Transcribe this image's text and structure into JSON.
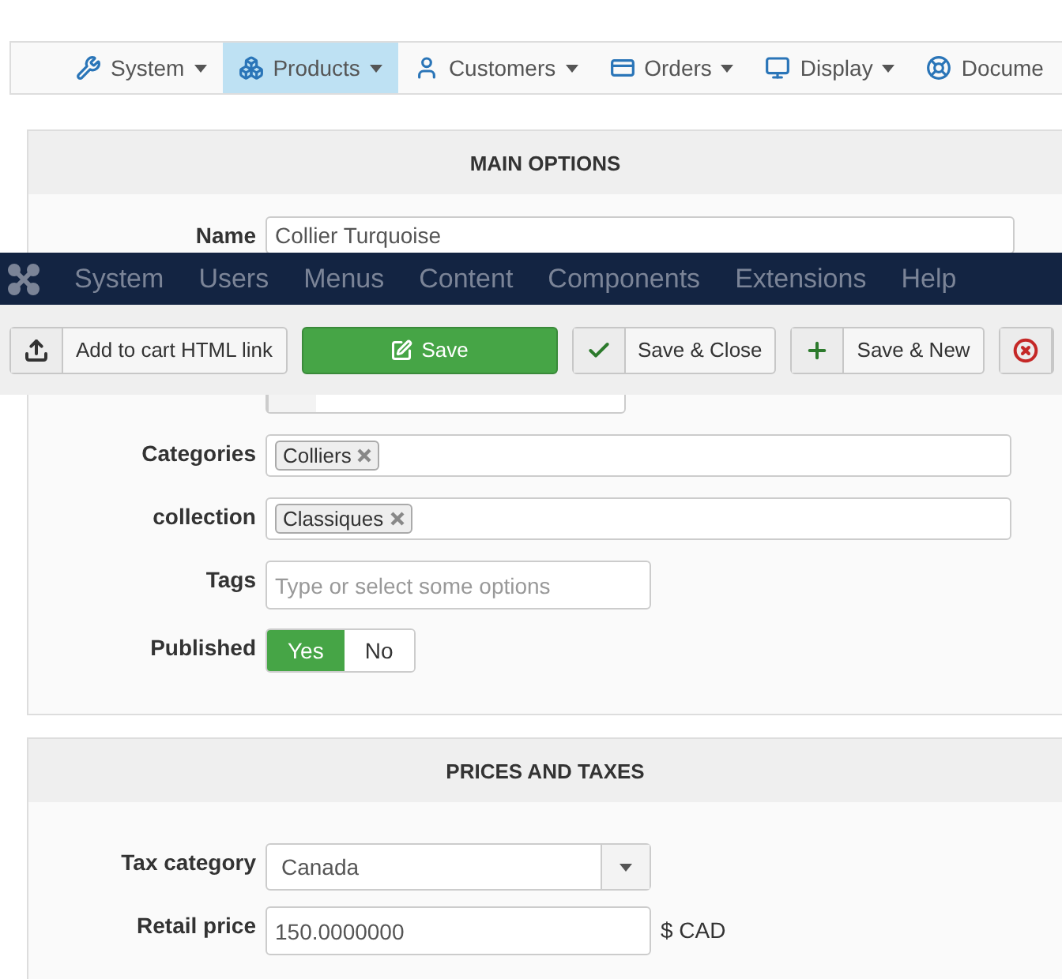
{
  "top_menu": [
    {
      "label": "System",
      "selected": false
    },
    {
      "label": "Products",
      "selected": true
    },
    {
      "label": "Customers",
      "selected": false
    },
    {
      "label": "Orders",
      "selected": false
    },
    {
      "label": "Display",
      "selected": false
    },
    {
      "label": "Docume",
      "selected": false
    }
  ],
  "main_options": {
    "title": "MAIN OPTIONS",
    "fields": [
      {
        "kind": "name",
        "label": "Name",
        "value": "Collier Turquoise"
      },
      {
        "kind": "select"
      },
      {
        "kind": "tags",
        "label": "Categories",
        "tags": [
          "Colliers"
        ]
      },
      {
        "kind": "tags",
        "label": "collection",
        "tags": [
          "Classiques"
        ]
      },
      {
        "kind": "text",
        "label": "Tags",
        "placeholder": "Type or select some options"
      },
      {
        "kind": "toggle",
        "label": "Published",
        "options": [
          {
            "label": "Yes",
            "selected": true
          },
          {
            "label": "No",
            "selected": false
          }
        ]
      }
    ]
  },
  "admin_menu": [
    "System",
    "Users",
    "Menus",
    "Content",
    "Components",
    "Extensions",
    "Help"
  ],
  "toolbar": [
    {
      "kind": "upload",
      "label": "Add to cart HTML link"
    },
    {
      "kind": "save",
      "label": "Save"
    },
    {
      "kind": "check",
      "label": "Save & Close"
    },
    {
      "kind": "plus",
      "label": "Save & New"
    },
    {
      "kind": "cancel"
    }
  ],
  "prices": {
    "title": "PRICES AND TAXES",
    "fields": [
      {
        "kind": "select",
        "label": "Tax category",
        "value": "Canada"
      },
      {
        "kind": "text",
        "label": "Retail price",
        "value": "150.0000000",
        "suffix": "$ CAD"
      }
    ]
  }
}
